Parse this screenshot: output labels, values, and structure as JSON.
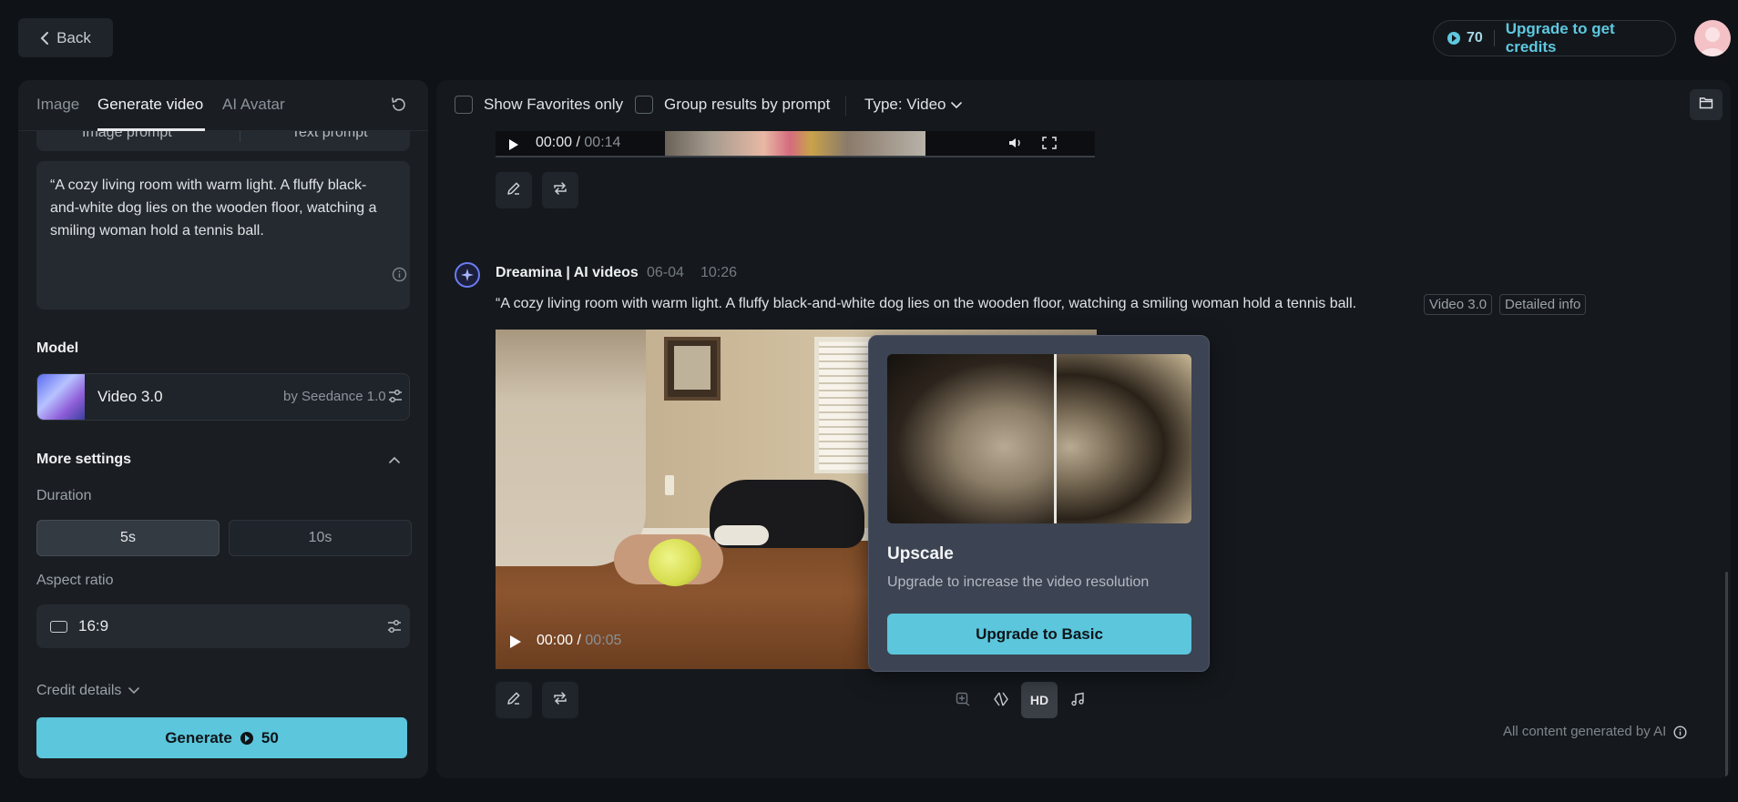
{
  "header": {
    "back_label": "Back",
    "credits_count": "70",
    "upgrade_label": "Upgrade to get credits"
  },
  "left_panel": {
    "tabs": [
      {
        "label": "Image"
      },
      {
        "label": "Generate video"
      },
      {
        "label": "AI Avatar"
      }
    ],
    "sub_tabs": [
      {
        "label": "Image prompt"
      },
      {
        "label": "Text prompt"
      }
    ],
    "prompt_text": "“A cozy living room with warm light. A fluffy black-and-white dog lies on the wooden floor, watching a smiling woman hold a tennis ball.",
    "model": {
      "section_label": "Model",
      "name": "Video 3.0",
      "by": "by Seedance 1.0"
    },
    "more_settings_label": "More settings",
    "duration": {
      "label": "Duration",
      "options": [
        "5s",
        "10s"
      ],
      "selected": "5s"
    },
    "aspect_ratio": {
      "label": "Aspect ratio",
      "value": "16:9"
    },
    "credit_details_label": "Credit details",
    "generate": {
      "label": "Generate",
      "cost": "50"
    }
  },
  "right_panel": {
    "filters": {
      "favorites_label": "Show Favorites only",
      "group_label": "Group results by prompt",
      "type_label": "Type: Video"
    },
    "previous_video": {
      "current_time": "00:00",
      "separator": "/",
      "duration": "00:14"
    },
    "generation": {
      "source": "Dreamina | AI videos",
      "date": "06-04",
      "time": "10:26",
      "prompt": "“A cozy living room with warm light. A fluffy black-and-white dog lies on the wooden floor, watching a smiling woman hold a tennis ball.",
      "model_tag": "Video 3.0",
      "info_tag": "Detailed info",
      "video": {
        "current_time": "00:00",
        "separator": "/",
        "duration": "00:05"
      },
      "hd_label": "HD"
    },
    "footer_note": "All content generated by AI"
  },
  "popup": {
    "title": "Upscale",
    "description": "Upgrade to increase the video resolution",
    "button_label": "Upgrade to Basic"
  },
  "colors": {
    "accent": "#5bc6dc",
    "background": "#0f1216",
    "panel": "#1a1e23"
  }
}
